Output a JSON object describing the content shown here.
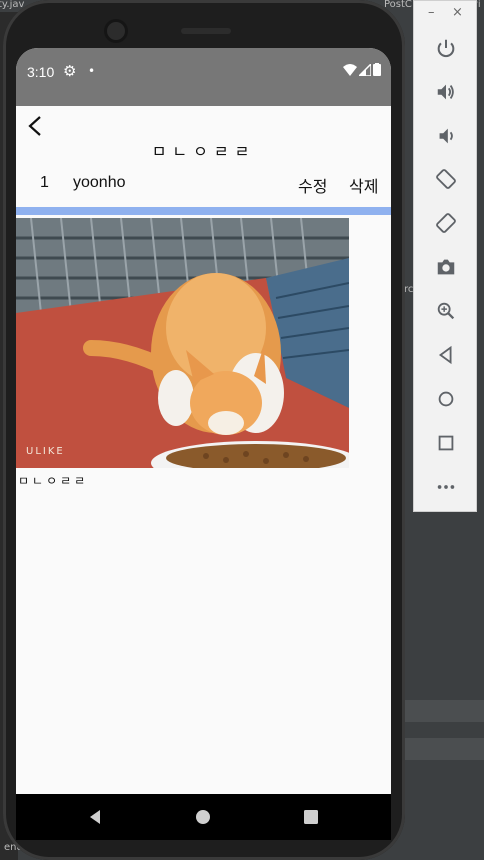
{
  "ide": {
    "tab_left": "ty.jav",
    "tab_right": "PostC",
    "tab_right2": "vi",
    "side_text1": "rc",
    "side_text2": "end"
  },
  "emulator_panel": {
    "minimize": "–",
    "close": "×",
    "buttons": [
      "power",
      "volume-up",
      "volume-down",
      "rotate-left",
      "rotate-right",
      "screenshot",
      "zoom",
      "back",
      "home",
      "overview",
      "more"
    ]
  },
  "statusbar": {
    "time": "3:10",
    "gear": "⚙",
    "dot": "•"
  },
  "appbar": {
    "title": "ㅁㄴㅇㄹㄹ"
  },
  "post": {
    "number": "1",
    "author": "yoonho",
    "edit_label": "수정",
    "delete_label": "삭제",
    "caption": "ㅁㄴㅇㄹㄹ",
    "photo_watermark": "ULIKE"
  },
  "colors": {
    "accent_divider": "#8fb1ef",
    "statusbar": "#777777"
  }
}
